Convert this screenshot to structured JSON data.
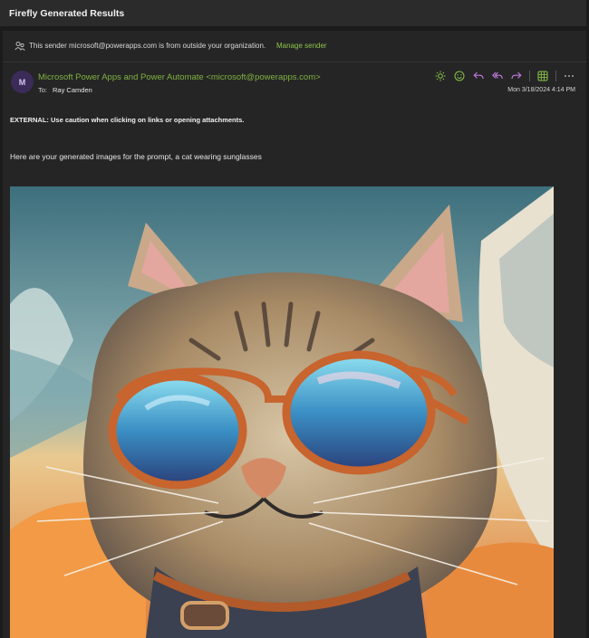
{
  "window": {
    "title": "Firefly Generated Results"
  },
  "banner": {
    "message": "This sender microsoft@powerapps.com is from outside your organization.",
    "action_label": "Manage sender"
  },
  "email": {
    "avatar_initial": "M",
    "sender": "Microsoft Power Apps and Power Automate <microsoft@powerapps.com>",
    "to_label": "To:",
    "to": "Ray Camden",
    "date": "Mon 3/18/2024 4:14 PM",
    "external_warning": "EXTERNAL: Use caution when clicking on links or opening attachments.",
    "body_intro": "Here are your generated images for the prompt, a cat wearing sunglasses"
  },
  "toolbar_icons": [
    "sun-icon",
    "emoji-icon",
    "reply-icon",
    "reply-all-icon",
    "forward-icon",
    "apps-icon",
    "more-icon"
  ],
  "colors": {
    "accent": "#7fb241",
    "background": "#252525"
  }
}
